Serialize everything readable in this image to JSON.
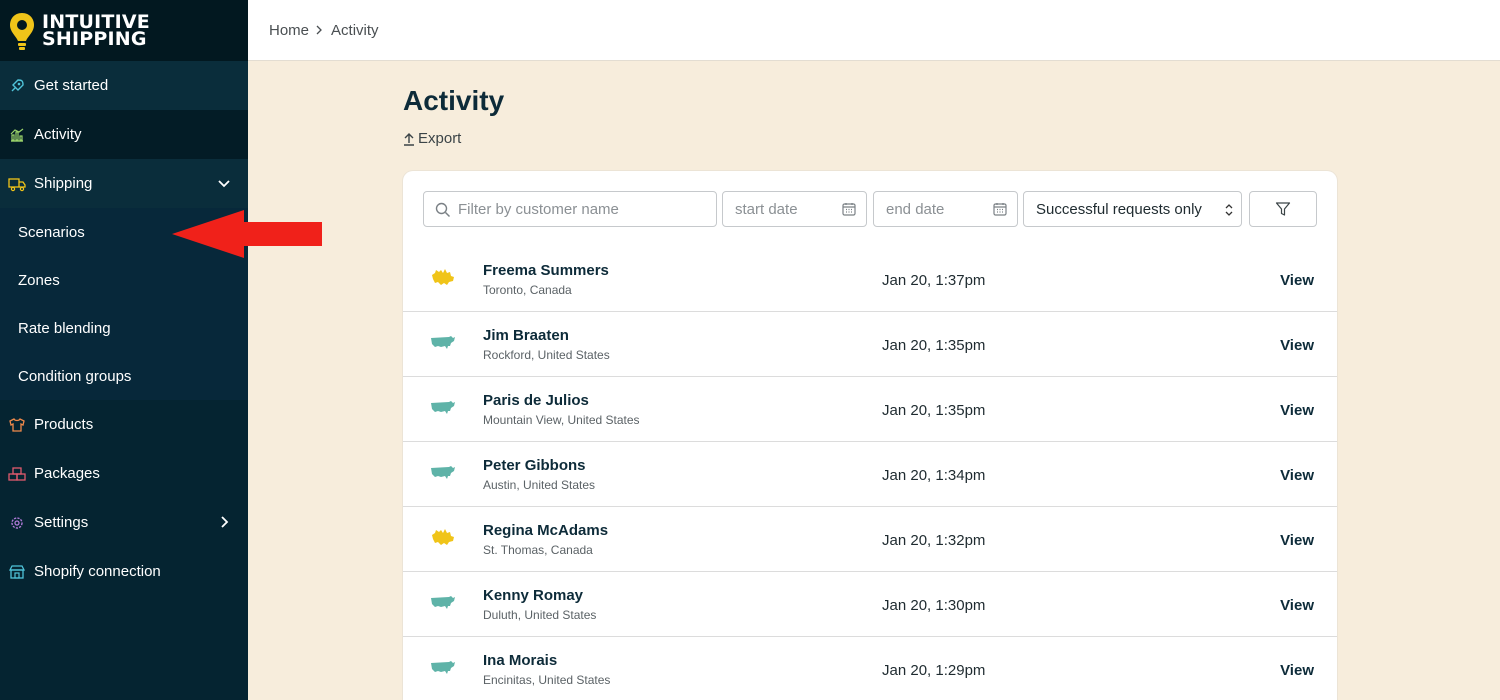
{
  "brand": {
    "line1": "INTUITIVE",
    "line2": "SHIPPING"
  },
  "sidebar": {
    "items": [
      {
        "label": "Get started",
        "icon": "rocket-icon"
      },
      {
        "label": "Activity",
        "icon": "chart-icon"
      },
      {
        "label": "Shipping",
        "icon": "truck-icon"
      },
      {
        "label": "Products",
        "icon": "shirt-icon"
      },
      {
        "label": "Packages",
        "icon": "boxes-icon"
      },
      {
        "label": "Settings",
        "icon": "gear-icon"
      },
      {
        "label": "Shopify connection",
        "icon": "shop-icon"
      }
    ],
    "shipping_sub": [
      "Scenarios",
      "Zones",
      "Rate blending",
      "Condition groups"
    ]
  },
  "breadcrumb": {
    "home": "Home",
    "current": "Activity"
  },
  "page": {
    "title": "Activity",
    "export": "Export"
  },
  "filters": {
    "search_placeholder": "Filter by customer name",
    "start_placeholder": "start date",
    "end_placeholder": "end date",
    "status_selected": "Successful requests only"
  },
  "rows": [
    {
      "name": "Freema Summers",
      "loc": "Toronto, Canada",
      "time": "Jan 20, 1:37pm",
      "action": "View",
      "country": "canada-map-icon"
    },
    {
      "name": "Jim Braaten",
      "loc": "Rockford, United States",
      "time": "Jan 20, 1:35pm",
      "action": "View",
      "country": "usa-map-icon"
    },
    {
      "name": "Paris de Julios",
      "loc": "Mountain View, United States",
      "time": "Jan 20, 1:35pm",
      "action": "View",
      "country": "usa-map-icon"
    },
    {
      "name": "Peter Gibbons",
      "loc": "Austin, United States",
      "time": "Jan 20, 1:34pm",
      "action": "View",
      "country": "usa-map-icon"
    },
    {
      "name": "Regina McAdams",
      "loc": "St. Thomas, Canada",
      "time": "Jan 20, 1:32pm",
      "action": "View",
      "country": "canada-map-icon"
    },
    {
      "name": "Kenny Romay",
      "loc": "Duluth, United States",
      "time": "Jan 20, 1:30pm",
      "action": "View",
      "country": "usa-map-icon"
    },
    {
      "name": "Ina Morais",
      "loc": "Encinitas, United States",
      "time": "Jan 20, 1:29pm",
      "action": "View",
      "country": "usa-map-icon"
    }
  ],
  "colors": {
    "sidebar": "#052431",
    "background": "#f7eddc",
    "canada": "#f0c419",
    "usa": "#5fb3a8",
    "arrow": "#f0211a"
  }
}
